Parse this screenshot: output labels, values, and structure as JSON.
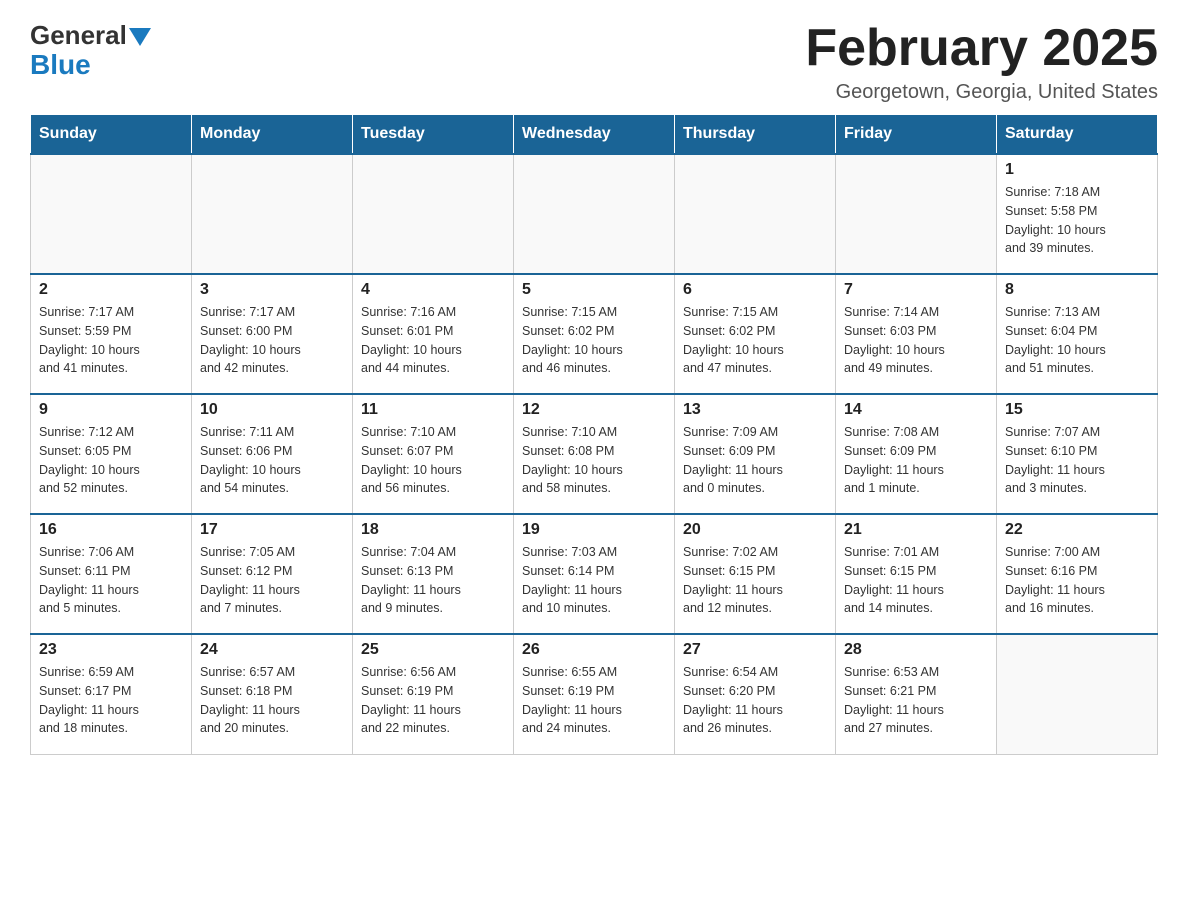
{
  "header": {
    "logo": {
      "general": "General",
      "blue": "Blue"
    },
    "title": "February 2025",
    "subtitle": "Georgetown, Georgia, United States"
  },
  "weekdays": [
    "Sunday",
    "Monday",
    "Tuesday",
    "Wednesday",
    "Thursday",
    "Friday",
    "Saturday"
  ],
  "weeks": [
    [
      {
        "day": "",
        "info": ""
      },
      {
        "day": "",
        "info": ""
      },
      {
        "day": "",
        "info": ""
      },
      {
        "day": "",
        "info": ""
      },
      {
        "day": "",
        "info": ""
      },
      {
        "day": "",
        "info": ""
      },
      {
        "day": "1",
        "info": "Sunrise: 7:18 AM\nSunset: 5:58 PM\nDaylight: 10 hours\nand 39 minutes."
      }
    ],
    [
      {
        "day": "2",
        "info": "Sunrise: 7:17 AM\nSunset: 5:59 PM\nDaylight: 10 hours\nand 41 minutes."
      },
      {
        "day": "3",
        "info": "Sunrise: 7:17 AM\nSunset: 6:00 PM\nDaylight: 10 hours\nand 42 minutes."
      },
      {
        "day": "4",
        "info": "Sunrise: 7:16 AM\nSunset: 6:01 PM\nDaylight: 10 hours\nand 44 minutes."
      },
      {
        "day": "5",
        "info": "Sunrise: 7:15 AM\nSunset: 6:02 PM\nDaylight: 10 hours\nand 46 minutes."
      },
      {
        "day": "6",
        "info": "Sunrise: 7:15 AM\nSunset: 6:02 PM\nDaylight: 10 hours\nand 47 minutes."
      },
      {
        "day": "7",
        "info": "Sunrise: 7:14 AM\nSunset: 6:03 PM\nDaylight: 10 hours\nand 49 minutes."
      },
      {
        "day": "8",
        "info": "Sunrise: 7:13 AM\nSunset: 6:04 PM\nDaylight: 10 hours\nand 51 minutes."
      }
    ],
    [
      {
        "day": "9",
        "info": "Sunrise: 7:12 AM\nSunset: 6:05 PM\nDaylight: 10 hours\nand 52 minutes."
      },
      {
        "day": "10",
        "info": "Sunrise: 7:11 AM\nSunset: 6:06 PM\nDaylight: 10 hours\nand 54 minutes."
      },
      {
        "day": "11",
        "info": "Sunrise: 7:10 AM\nSunset: 6:07 PM\nDaylight: 10 hours\nand 56 minutes."
      },
      {
        "day": "12",
        "info": "Sunrise: 7:10 AM\nSunset: 6:08 PM\nDaylight: 10 hours\nand 58 minutes."
      },
      {
        "day": "13",
        "info": "Sunrise: 7:09 AM\nSunset: 6:09 PM\nDaylight: 11 hours\nand 0 minutes."
      },
      {
        "day": "14",
        "info": "Sunrise: 7:08 AM\nSunset: 6:09 PM\nDaylight: 11 hours\nand 1 minute."
      },
      {
        "day": "15",
        "info": "Sunrise: 7:07 AM\nSunset: 6:10 PM\nDaylight: 11 hours\nand 3 minutes."
      }
    ],
    [
      {
        "day": "16",
        "info": "Sunrise: 7:06 AM\nSunset: 6:11 PM\nDaylight: 11 hours\nand 5 minutes."
      },
      {
        "day": "17",
        "info": "Sunrise: 7:05 AM\nSunset: 6:12 PM\nDaylight: 11 hours\nand 7 minutes."
      },
      {
        "day": "18",
        "info": "Sunrise: 7:04 AM\nSunset: 6:13 PM\nDaylight: 11 hours\nand 9 minutes."
      },
      {
        "day": "19",
        "info": "Sunrise: 7:03 AM\nSunset: 6:14 PM\nDaylight: 11 hours\nand 10 minutes."
      },
      {
        "day": "20",
        "info": "Sunrise: 7:02 AM\nSunset: 6:15 PM\nDaylight: 11 hours\nand 12 minutes."
      },
      {
        "day": "21",
        "info": "Sunrise: 7:01 AM\nSunset: 6:15 PM\nDaylight: 11 hours\nand 14 minutes."
      },
      {
        "day": "22",
        "info": "Sunrise: 7:00 AM\nSunset: 6:16 PM\nDaylight: 11 hours\nand 16 minutes."
      }
    ],
    [
      {
        "day": "23",
        "info": "Sunrise: 6:59 AM\nSunset: 6:17 PM\nDaylight: 11 hours\nand 18 minutes."
      },
      {
        "day": "24",
        "info": "Sunrise: 6:57 AM\nSunset: 6:18 PM\nDaylight: 11 hours\nand 20 minutes."
      },
      {
        "day": "25",
        "info": "Sunrise: 6:56 AM\nSunset: 6:19 PM\nDaylight: 11 hours\nand 22 minutes."
      },
      {
        "day": "26",
        "info": "Sunrise: 6:55 AM\nSunset: 6:19 PM\nDaylight: 11 hours\nand 24 minutes."
      },
      {
        "day": "27",
        "info": "Sunrise: 6:54 AM\nSunset: 6:20 PM\nDaylight: 11 hours\nand 26 minutes."
      },
      {
        "day": "28",
        "info": "Sunrise: 6:53 AM\nSunset: 6:21 PM\nDaylight: 11 hours\nand 27 minutes."
      },
      {
        "day": "",
        "info": ""
      }
    ]
  ]
}
